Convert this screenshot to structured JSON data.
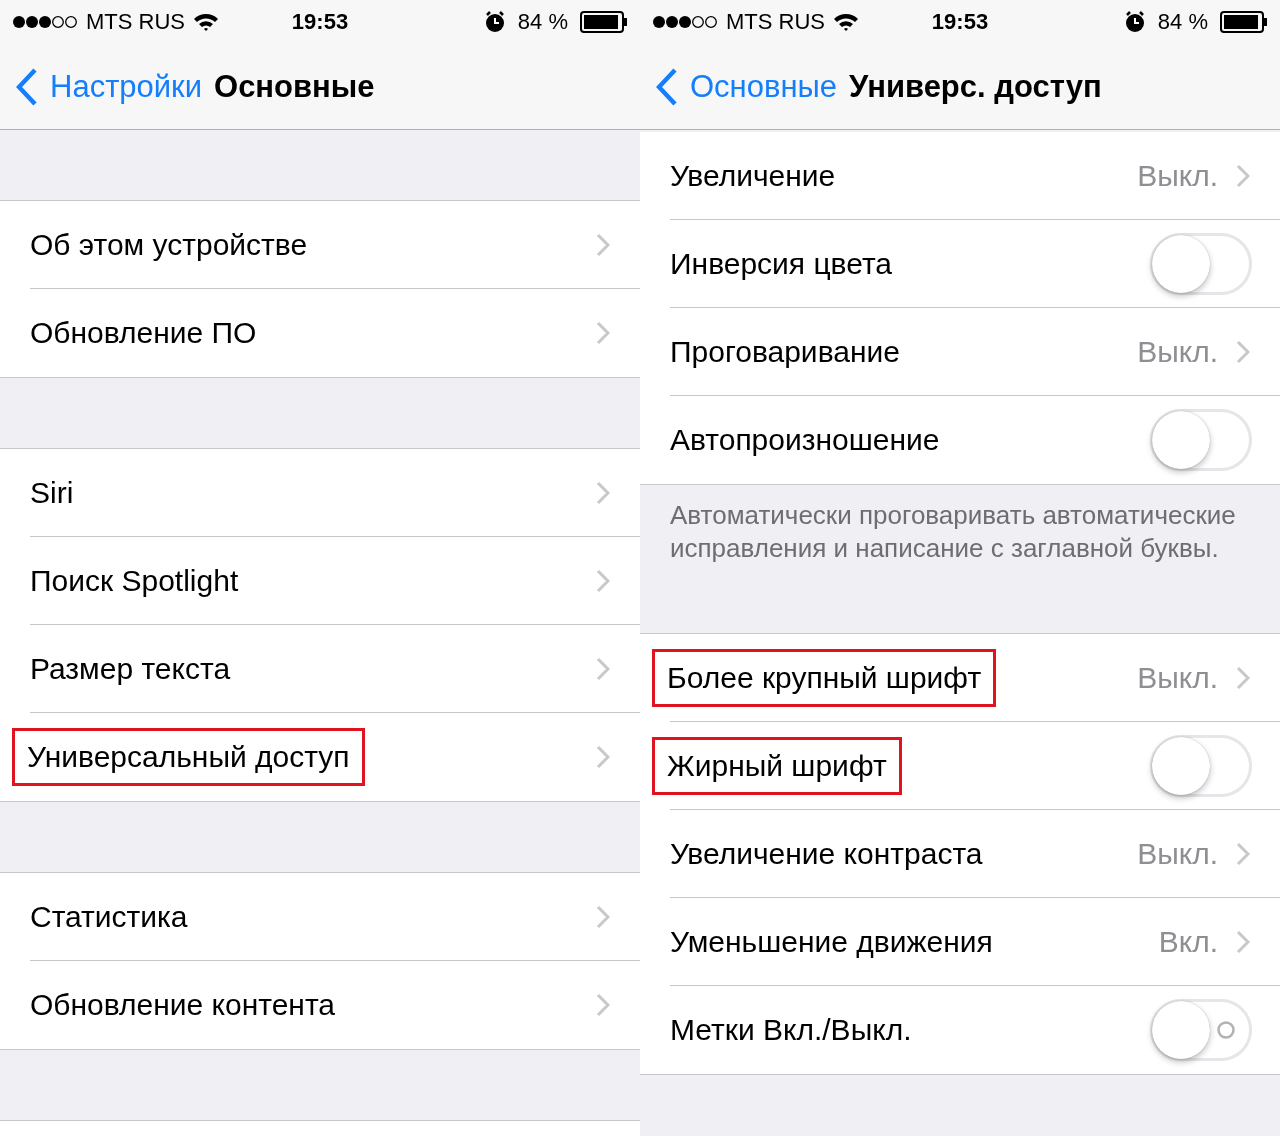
{
  "screens": [
    {
      "status_bar": {
        "carrier": "MTS RUS",
        "time": "19:53",
        "battery": "84 %"
      },
      "nav": {
        "back": "Настройки",
        "title": "Основные"
      },
      "scrolled": false,
      "sections": [
        {
          "rows": [
            {
              "label": "Об этом устройстве",
              "kind": "disclosure",
              "highlighted": false
            },
            {
              "label": "Обновление ПО",
              "kind": "disclosure",
              "highlighted": false
            }
          ]
        },
        {
          "rows": [
            {
              "label": "Siri",
              "kind": "disclosure",
              "highlighted": false
            },
            {
              "label": "Поиск Spotlight",
              "kind": "disclosure",
              "highlighted": false
            },
            {
              "label": "Размер текста",
              "kind": "disclosure",
              "highlighted": false
            },
            {
              "label": "Универсальный доступ",
              "kind": "disclosure",
              "highlighted": true
            }
          ]
        },
        {
          "rows": [
            {
              "label": "Статистика",
              "kind": "disclosure",
              "highlighted": false
            },
            {
              "label": "Обновление контента",
              "kind": "disclosure",
              "highlighted": false
            }
          ]
        }
      ]
    },
    {
      "status_bar": {
        "carrier": "MTS RUS",
        "time": "19:53",
        "battery": "84 %"
      },
      "nav": {
        "back": "Основные",
        "title": "Универс. доступ"
      },
      "scrolled": true,
      "sections": [
        {
          "rows": [
            {
              "label": "Увеличение",
              "kind": "disclosure",
              "value": "Выкл.",
              "highlighted": false
            },
            {
              "label": "Инверсия цвета",
              "kind": "toggle",
              "on": false,
              "highlighted": false
            },
            {
              "label": "Проговаривание",
              "kind": "disclosure",
              "value": "Выкл.",
              "highlighted": false
            },
            {
              "label": "Автопроизношение",
              "kind": "toggle",
              "on": false,
              "highlighted": false
            }
          ],
          "footer": "Автоматически проговаривать автоматические исправления и написание с заглавной буквы."
        },
        {
          "rows": [
            {
              "label": "Более крупный шрифт",
              "kind": "disclosure",
              "value": "Выкл.",
              "highlighted": true
            },
            {
              "label": "Жирный шрифт",
              "kind": "toggle",
              "on": false,
              "highlighted": true
            },
            {
              "label": "Увеличение контраста",
              "kind": "disclosure",
              "value": "Выкл.",
              "highlighted": false
            },
            {
              "label": "Уменьшение движения",
              "kind": "disclosure",
              "value": "Вкл.",
              "highlighted": false
            },
            {
              "label": "Метки Вкл./Выкл.",
              "kind": "toggle",
              "on": false,
              "on_off_labels": true,
              "highlighted": false
            }
          ]
        }
      ]
    }
  ]
}
